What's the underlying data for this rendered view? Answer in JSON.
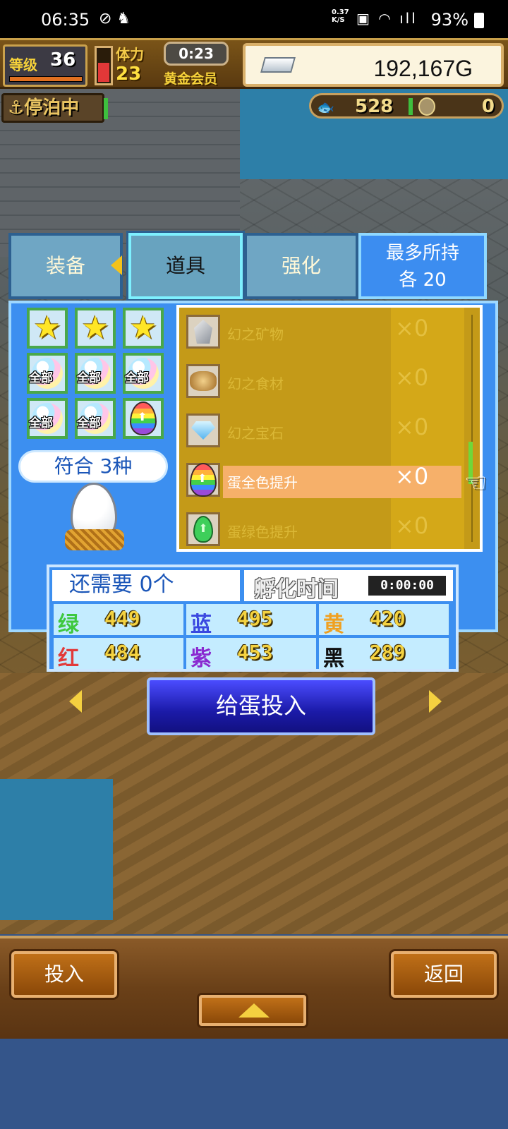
{
  "status_bar": {
    "time": "06:35",
    "network_speed_top": "0.37",
    "network_speed_bottom": "K/S",
    "battery": "93%"
  },
  "hud": {
    "level_label": "等级",
    "level_value": "36",
    "stamina_label": "体力",
    "stamina_value": "23",
    "stamina_fill_fraction": 0.55,
    "timer": "0:23",
    "member_label": "黄金会员",
    "money": "192,167G",
    "docked_label": "⚓停泊中",
    "resource_1": "528",
    "resource_2": "0"
  },
  "tabs": {
    "equipment": "装备",
    "items": "道具",
    "enhance": "强化",
    "max_hold_line1": "最多所持",
    "max_hold_line2": "各  20"
  },
  "filters": {
    "slots": [
      {
        "icon": "star-icon"
      },
      {
        "icon": "star-icon"
      },
      {
        "icon": "star-icon"
      },
      {
        "icon": "all-icon",
        "label": "全部"
      },
      {
        "icon": "all-icon",
        "label": "全部"
      },
      {
        "icon": "all-icon",
        "label": "全部"
      },
      {
        "icon": "all-icon",
        "label": "全部"
      },
      {
        "icon": "all-icon",
        "label": "全部"
      },
      {
        "icon": "rainbow-egg-icon"
      }
    ],
    "match_text": "符合 3种"
  },
  "items": [
    {
      "name": "幻之矿物",
      "qty": "×0",
      "icon": "mineral-icon"
    },
    {
      "name": "幻之食材",
      "qty": "×0",
      "icon": "food-icon"
    },
    {
      "name": "幻之宝石",
      "qty": "×0",
      "icon": "gem-icon"
    },
    {
      "name": "蛋全色提升",
      "qty": "×0",
      "icon": "rainbow-egg-icon",
      "selected": true
    },
    {
      "name": "蛋绿色提升",
      "qty": "×0",
      "icon": "green-egg-icon"
    }
  ],
  "stats": {
    "need_text": "还需要 0个",
    "hatch_label": "孵化时间",
    "hatch_time": "0:00:00",
    "colors": [
      {
        "label": "绿",
        "value": "449",
        "color": "#3ec83e"
      },
      {
        "label": "蓝",
        "value": "495",
        "color": "#3a48e0"
      },
      {
        "label": "黄",
        "value": "420",
        "color": "#f0a020"
      },
      {
        "label": "红",
        "value": "484",
        "color": "#e23a3a"
      },
      {
        "label": "紫",
        "value": "453",
        "color": "#8a2ad0"
      },
      {
        "label": "黑",
        "value": "289",
        "color": "#111111"
      }
    ]
  },
  "actions": {
    "feed_button": "给蛋投入",
    "insert_button": "投入",
    "back_button": "返回"
  }
}
